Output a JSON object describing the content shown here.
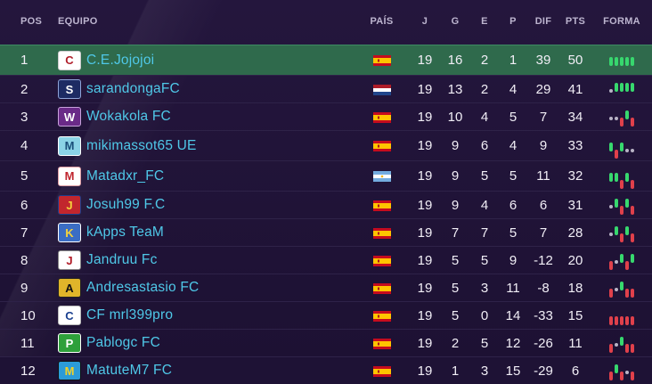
{
  "headers": {
    "pos": "POS",
    "team": "EQUIPO",
    "country": "PAÍS",
    "played": "J",
    "won": "G",
    "drawn": "E",
    "lost": "P",
    "diff": "DIF",
    "points": "PTS",
    "form": "FORMA"
  },
  "colors": {
    "background": "#1e1235",
    "highlight_row": "#2f6a4c",
    "team_name": "#4fc8e8",
    "win": "#37d86e",
    "loss": "#e0404b",
    "draw": "#b9b4c6"
  },
  "rows": [
    {
      "pos": "1",
      "team": "C.E.Jojojoi",
      "crest": "C",
      "country": "spain",
      "j": "19",
      "g": "16",
      "e": "2",
      "p": "1",
      "dif": "39",
      "pts": "50",
      "form": [
        "w",
        "w",
        "w",
        "w",
        "w"
      ]
    },
    {
      "pos": "2",
      "team": "sarandongaFC",
      "crest": "S",
      "country": "netherlands",
      "j": "19",
      "g": "13",
      "e": "2",
      "p": "4",
      "dif": "29",
      "pts": "41",
      "form": [
        "d",
        "w",
        "w",
        "w",
        "w"
      ]
    },
    {
      "pos": "3",
      "team": "Wokakola FC",
      "crest": "W",
      "country": "spain",
      "j": "19",
      "g": "10",
      "e": "4",
      "p": "5",
      "dif": "7",
      "pts": "34",
      "form": [
        "d",
        "d",
        "l",
        "w",
        "l"
      ]
    },
    {
      "pos": "4",
      "team": "mikimassot65 UE",
      "crest": "M",
      "country": "spain",
      "j": "19",
      "g": "9",
      "e": "6",
      "p": "4",
      "dif": "9",
      "pts": "33",
      "form": [
        "w",
        "l",
        "w",
        "d",
        "d"
      ]
    },
    {
      "pos": "5",
      "team": "Matadxr_FC",
      "crest": "M",
      "country": "argentina",
      "j": "19",
      "g": "9",
      "e": "5",
      "p": "5",
      "dif": "11",
      "pts": "32",
      "form": [
        "w",
        "w",
        "l",
        "w",
        "l"
      ]
    },
    {
      "pos": "6",
      "team": "Josuh99 F.C",
      "crest": "J",
      "country": "spain",
      "j": "19",
      "g": "9",
      "e": "4",
      "p": "6",
      "dif": "6",
      "pts": "31",
      "form": [
        "d",
        "w",
        "l",
        "w",
        "l"
      ]
    },
    {
      "pos": "7",
      "team": "kApps TeaM",
      "crest": "K",
      "country": "spain",
      "j": "19",
      "g": "7",
      "e": "7",
      "p": "5",
      "dif": "7",
      "pts": "28",
      "form": [
        "d",
        "w",
        "l",
        "w",
        "l"
      ]
    },
    {
      "pos": "8",
      "team": "Jandruu Fc",
      "crest": "J",
      "country": "spain",
      "j": "19",
      "g": "5",
      "e": "5",
      "p": "9",
      "dif": "-12",
      "pts": "20",
      "form": [
        "l",
        "d",
        "w",
        "l",
        "w"
      ]
    },
    {
      "pos": "9",
      "team": "Andresastasio FC",
      "crest": "A",
      "country": "spain",
      "j": "19",
      "g": "5",
      "e": "3",
      "p": "11",
      "dif": "-8",
      "pts": "18",
      "form": [
        "l",
        "d",
        "w",
        "l",
        "l"
      ]
    },
    {
      "pos": "10",
      "team": "CF mrl399pro",
      "crest": "C",
      "country": "spain",
      "j": "19",
      "g": "5",
      "e": "0",
      "p": "14",
      "dif": "-33",
      "pts": "15",
      "form": [
        "l",
        "l",
        "l",
        "l",
        "l"
      ]
    },
    {
      "pos": "11",
      "team": "Pablogc FC",
      "crest": "P",
      "country": "spain",
      "j": "19",
      "g": "2",
      "e": "5",
      "p": "12",
      "dif": "-26",
      "pts": "11",
      "form": [
        "l",
        "d",
        "w",
        "l",
        "l"
      ]
    },
    {
      "pos": "12",
      "team": "MatuteM7 FC",
      "crest": "M",
      "country": "spain",
      "j": "19",
      "g": "1",
      "e": "3",
      "p": "15",
      "dif": "-29",
      "pts": "6",
      "form": [
        "l",
        "w",
        "l",
        "d",
        "l"
      ]
    }
  ]
}
